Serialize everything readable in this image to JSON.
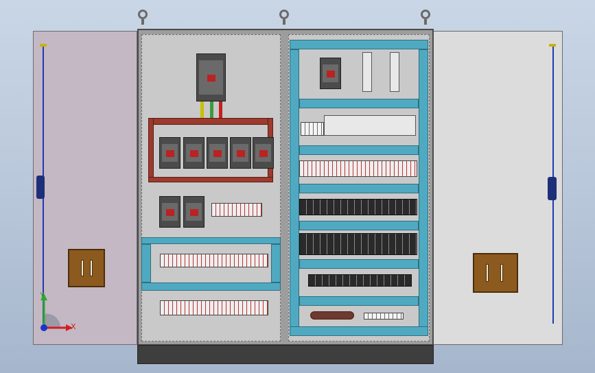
{
  "viewport": {
    "title": ""
  },
  "triad": {
    "x_label": "X",
    "y_label": "Y"
  },
  "colors": {
    "background": "#b7c6d9",
    "cabinet_interior": "#c9c9c9",
    "din_rail": "#4fa9c1",
    "busbar": "#9c3a2e",
    "handle": "#8c5a1e",
    "hinge_rod": "#1f3ab0"
  },
  "parts": {
    "left_door": "left-door",
    "right_door": "right-door",
    "main_breaker": "main-breaker",
    "feeder_breakers": 5,
    "sub_breakers": 2,
    "lifting_eyes": 3
  }
}
